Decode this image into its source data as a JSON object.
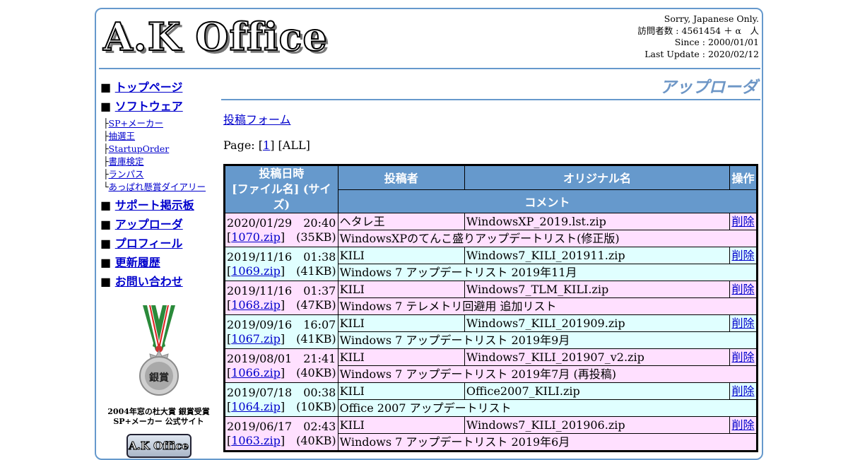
{
  "site": {
    "logo": "A.K Office",
    "notice": "Sorry, Japanese Only.",
    "visitors": "訪問者数 : 4561454 ＋ α　人",
    "since": "Since : 2000/01/01",
    "last_update": "Last Update : 2020/02/12"
  },
  "sidebar": {
    "bullet": "■",
    "top": "トップページ",
    "software": "ソフトウェア",
    "sub_items": [
      {
        "prefix": "├",
        "label": "SP+メーカー"
      },
      {
        "prefix": "├",
        "label": "抽選王"
      },
      {
        "prefix": "├",
        "label": "StartupOrder"
      },
      {
        "prefix": "├",
        "label": "書庫検定"
      },
      {
        "prefix": "├",
        "label": "ランパス"
      },
      {
        "prefix": "└",
        "label": "あっぱれ懸賞ダイアリー"
      }
    ],
    "after": [
      "サポート掲示板",
      "アップローダ",
      "プロフィール",
      "更新履歴",
      "お問い合わせ"
    ],
    "medal_text": "銀賞",
    "award_caption_1": "2004年窓の杜大賞 銀賞受賞",
    "award_caption_2": "SP+メーカー 公式サイト",
    "badge": "A.K Office"
  },
  "main": {
    "title": "アップローダ",
    "post_form": "投稿フォーム",
    "page_prefix": "Page: [",
    "page_current": "1",
    "page_suffix": "] [ALL]"
  },
  "table": {
    "headers": {
      "date": "投稿日時",
      "file": "[ファイル名] (サイズ)",
      "poster": "投稿者",
      "original": "オリジナル名",
      "op": "操作",
      "comment": "コメント"
    },
    "delete_label": "削除",
    "rows": [
      {
        "date": "2020/01/29　20:40",
        "file": "1070.zip",
        "size": "(35KB)",
        "poster": "ヘタレ王",
        "original": "WindowsXP_2019.lst.zip",
        "comment": "WindowsXPのてんこ盛りアップデートリスト(修正版)",
        "color": "pink"
      },
      {
        "date": "2019/11/16　01:38",
        "file": "1069.zip",
        "size": "(41KB)",
        "poster": "KILI",
        "original": "Windows7_KILI_201911.zip",
        "comment": "Windows 7 アップデートリスト 2019年11月",
        "color": "cyan"
      },
      {
        "date": "2019/11/16　01:37",
        "file": "1068.zip",
        "size": "(47KB)",
        "poster": "KILI",
        "original": "Windows7_TLM_KILI.zip",
        "comment": "Windows 7 テレメトリ回避用 追加リスト",
        "color": "pink"
      },
      {
        "date": "2019/09/16　16:07",
        "file": "1067.zip",
        "size": "(41KB)",
        "poster": "KILI",
        "original": "Windows7_KILI_201909.zip",
        "comment": "Windows 7 アップデートリスト 2019年9月",
        "color": "cyan"
      },
      {
        "date": "2019/08/01　21:41",
        "file": "1066.zip",
        "size": "(40KB)",
        "poster": "KILI",
        "original": "Windows7_KILI_201907_v2.zip",
        "comment": "Windows 7 アップデートリスト 2019年7月 (再投稿)",
        "color": "pink"
      },
      {
        "date": "2019/07/18　00:38",
        "file": "1064.zip",
        "size": "(10KB)",
        "poster": "KILI",
        "original": "Office2007_KILI.zip",
        "comment": "Office 2007 アップデートリスト",
        "color": "cyan"
      },
      {
        "date": "2019/06/17　02:43",
        "file": "1063.zip",
        "size": "(40KB)",
        "poster": "KILI",
        "original": "Windows7_KILI_201906.zip",
        "comment": "Windows 7 アップデートリスト 2019年6月",
        "color": "pink"
      }
    ]
  }
}
